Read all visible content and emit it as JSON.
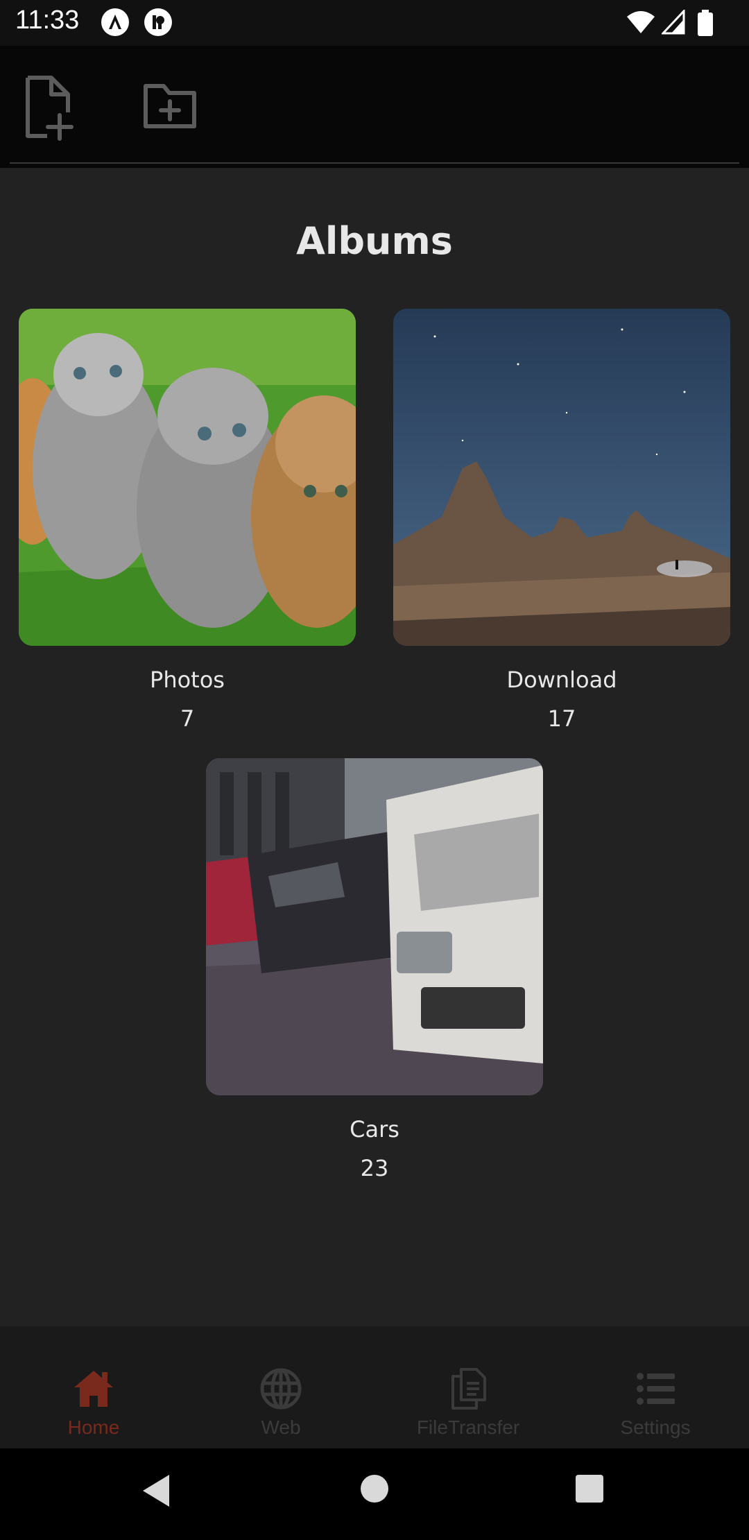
{
  "status_bar": {
    "time": "11:33"
  },
  "toolbar": {
    "new_file_icon": "file-plus-icon",
    "new_folder_icon": "folder-plus-icon"
  },
  "page": {
    "title": "Albums"
  },
  "albums": [
    {
      "name": "Photos",
      "count": "7",
      "thumb": "kittens-on-grass"
    },
    {
      "name": "Download",
      "count": "17",
      "thumb": "desert-night-sky"
    },
    {
      "name": "Cars",
      "count": "23",
      "thumb": "parked-cars-row"
    }
  ],
  "bottom_nav": {
    "items": [
      {
        "label": "Home",
        "icon": "home-icon",
        "active": true
      },
      {
        "label": "Web",
        "icon": "globe-icon",
        "active": false
      },
      {
        "label": "FileTransfer",
        "icon": "files-icon",
        "active": false
      },
      {
        "label": "Settings",
        "icon": "list-icon",
        "active": false
      }
    ]
  },
  "colors": {
    "background": "#222222",
    "toolbar": "#070707",
    "accent_active": "#7a2a1c",
    "nav_inactive": "#3b3b3b"
  }
}
